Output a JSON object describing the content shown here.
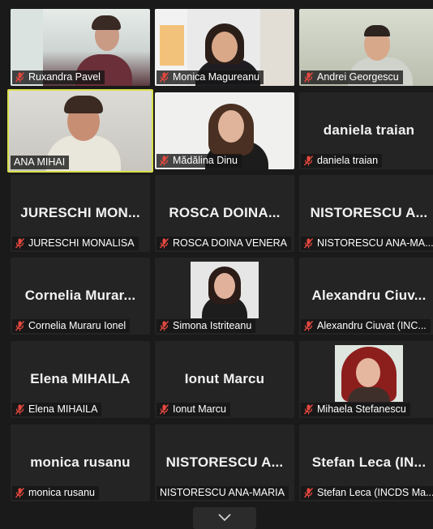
{
  "participants": [
    {
      "name": "Ruxandra Pavel",
      "label": "Ruxandra Pavel",
      "video": true,
      "muted": true
    },
    {
      "name": "Monica Magureanu",
      "label": "Monica Magureanu",
      "video": true,
      "muted": true
    },
    {
      "name": "Andrei Georgescu",
      "label": "Andrei Georgescu",
      "video": true,
      "muted": true
    },
    {
      "name": "ANA MIHAI",
      "label": "ANA MIHAI",
      "video": true,
      "muted": false,
      "active_speaker": true
    },
    {
      "name": "Mădălina Dinu",
      "label": "Mădălina Dinu",
      "video": true,
      "muted": true
    },
    {
      "name": "daniela traian",
      "label": "daniela traian",
      "video": false,
      "muted": true
    },
    {
      "name": "JURESCHI MON...",
      "label": "JURESCHI MONALISA",
      "video": false,
      "muted": true
    },
    {
      "name": "ROSCA DOINA...",
      "label": "ROSCA DOINA VENERA",
      "video": false,
      "muted": true
    },
    {
      "name": "NISTORESCU A...",
      "label": "NISTORESCU ANA-MA...",
      "video": false,
      "muted": true
    },
    {
      "name": "Cornelia Murar...",
      "label": "Cornelia Muraru Ionel",
      "video": false,
      "muted": true
    },
    {
      "name": "Simona Istriteanu",
      "label": "Simona Istriteanu",
      "video": false,
      "photo": true,
      "muted": true
    },
    {
      "name": "Alexandru Ciuv...",
      "label": "Alexandru Ciuvat (INC...",
      "video": false,
      "muted": true
    },
    {
      "name": "Elena MIHAILA",
      "label": "Elena MIHAILA",
      "video": false,
      "muted": true
    },
    {
      "name": "Ionut Marcu",
      "label": "Ionut Marcu",
      "video": false,
      "muted": true
    },
    {
      "name": "Mihaela Stefanescu",
      "label": "Mihaela Stefanescu",
      "video": false,
      "photo": true,
      "muted": true
    },
    {
      "name": "monica rusanu",
      "label": "monica rusanu",
      "video": false,
      "muted": true
    },
    {
      "name": "NISTORESCU A...",
      "label": "NISTORESCU ANA-MARIA",
      "video": false,
      "muted": false
    },
    {
      "name": "Stefan Leca (IN...",
      "label": "Stefan Leca (INCDS Ma...",
      "video": false,
      "muted": true
    }
  ],
  "icons": {
    "muted": "mic-muted-icon",
    "next_page": "chevron-down-icon"
  },
  "colors": {
    "background": "#1a1a1a",
    "tile": "#242424",
    "active_border": "#d9e04a",
    "mute_red": "#e5483f"
  }
}
